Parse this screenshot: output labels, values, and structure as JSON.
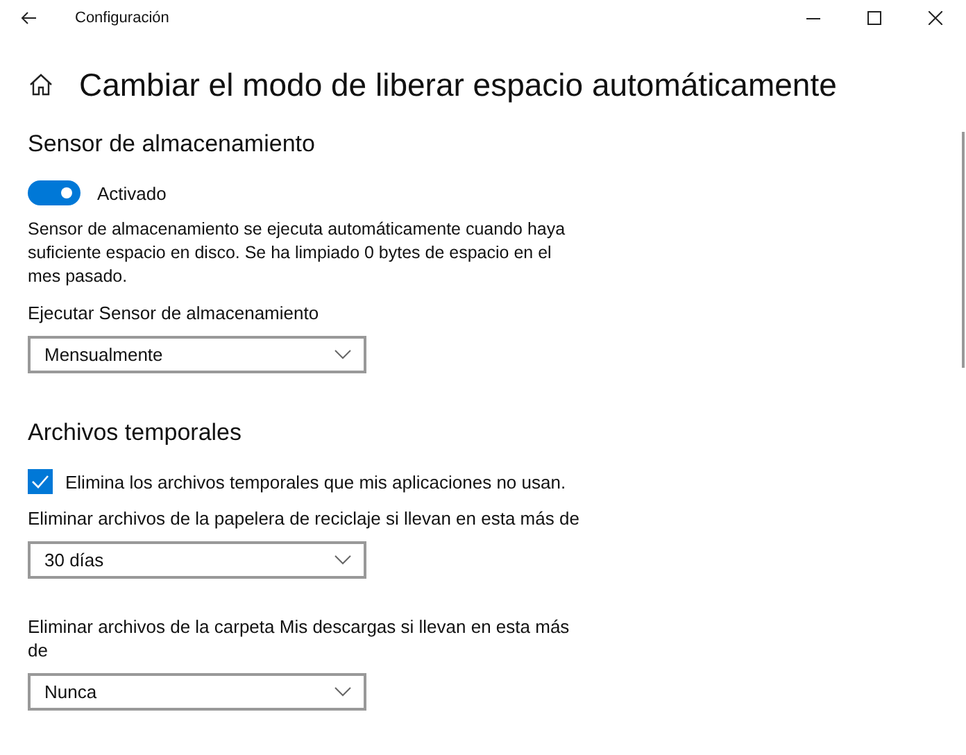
{
  "window": {
    "title": "Configuración"
  },
  "heading": "Cambiar el modo de liberar espacio automáticamente",
  "sections": [
    {
      "title": "Sensor de almacenamiento",
      "items": [
        {
          "kind": "toggle",
          "on": true,
          "label": "Activado"
        },
        {
          "kind": "text",
          "text": "Sensor de almacenamiento se ejecuta automáticamente cuando haya suficiente espacio en disco. Se ha limpiado 0 bytes de espacio en el mes pasado."
        },
        {
          "kind": "dropdown",
          "label": "Ejecutar Sensor de almacenamiento",
          "value": "Mensualmente"
        }
      ]
    },
    {
      "title": "Archivos temporales",
      "items": [
        {
          "kind": "checkbox",
          "checked": true,
          "label": "Elimina los archivos temporales que mis aplicaciones no usan."
        },
        {
          "kind": "dropdown",
          "label": "Eliminar archivos de la papelera de reciclaje si llevan en esta más de",
          "value": "30 días"
        },
        {
          "kind": "dropdown",
          "label": "Eliminar archivos de la carpeta Mis descargas si llevan en esta más de",
          "value": "Nunca"
        }
      ]
    }
  ]
}
